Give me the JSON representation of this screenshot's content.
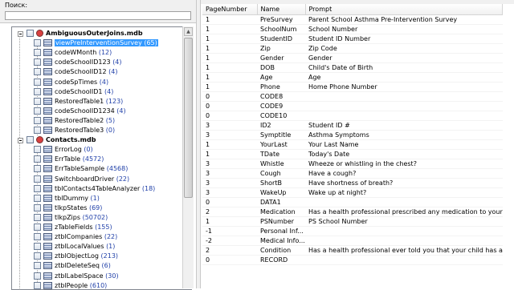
{
  "search": {
    "label": "Поиск:",
    "value": ""
  },
  "tree": {
    "databases": [
      {
        "name": "AmbiguousOuterJoins.mdb",
        "tables": [
          {
            "name": "viewPreInterventionSurvey",
            "count": "(65)",
            "selected": true
          },
          {
            "name": "codeWMonth",
            "count": "(12)"
          },
          {
            "name": "codeSchoolID123",
            "count": "(4)"
          },
          {
            "name": "codeSchoolID12",
            "count": "(4)"
          },
          {
            "name": "codeSpTimes",
            "count": "(4)"
          },
          {
            "name": "codeSchoolID1",
            "count": "(4)"
          },
          {
            "name": "RestoredTable1",
            "count": "(123)"
          },
          {
            "name": "codeSchoolID1234",
            "count": "(4)"
          },
          {
            "name": "RestoredTable2",
            "count": "(5)"
          },
          {
            "name": "RestoredTable3",
            "count": "(0)"
          }
        ]
      },
      {
        "name": "Contacts.mdb",
        "tables": [
          {
            "name": "ErrorLog",
            "count": "(0)"
          },
          {
            "name": "ErrTable",
            "count": "(4572)"
          },
          {
            "name": "ErrTableSample",
            "count": "(4568)"
          },
          {
            "name": "SwitchboardDriver",
            "count": "(22)"
          },
          {
            "name": "tblContacts4TableAnalyzer",
            "count": "(18)"
          },
          {
            "name": "tblDummy",
            "count": "(1)"
          },
          {
            "name": "tlkpStates",
            "count": "(69)"
          },
          {
            "name": "tlkpZips",
            "count": "(50702)"
          },
          {
            "name": "zTableFields",
            "count": "(155)"
          },
          {
            "name": "ztblCompanies",
            "count": "(22)"
          },
          {
            "name": "ztblLocalValues",
            "count": "(1)"
          },
          {
            "name": "ztblObjectLog",
            "count": "(213)"
          },
          {
            "name": "ztblDeleteSeq",
            "count": "(6)"
          },
          {
            "name": "ztblLabelSpace",
            "count": "(30)"
          },
          {
            "name": "ztblPeople",
            "count": "(610)"
          }
        ]
      }
    ]
  },
  "grid": {
    "columns": [
      "PageNumber",
      "Name",
      "Prompt"
    ],
    "rows": [
      [
        "1",
        "PreSurvey",
        "Parent School Asthma Pre-Intervention Survey"
      ],
      [
        "1",
        "SchoolNum",
        "School Number"
      ],
      [
        "1",
        "StudentID",
        "Student ID Number"
      ],
      [
        "1",
        "Zip",
        "Zip Code"
      ],
      [
        "1",
        "Gender",
        "Gender"
      ],
      [
        "1",
        "DOB",
        "Child's Date of Birth"
      ],
      [
        "1",
        "Age",
        "Age"
      ],
      [
        "1",
        "Phone",
        "Home Phone Number"
      ],
      [
        "0",
        "CODE8",
        ""
      ],
      [
        "0",
        "CODE9",
        ""
      ],
      [
        "0",
        "CODE10",
        ""
      ],
      [
        "3",
        "ID2",
        "Student ID #"
      ],
      [
        "3",
        "Symptitle",
        "Asthma Symptoms"
      ],
      [
        "1",
        "YourLast",
        "Your Last Name"
      ],
      [
        "1",
        "TDate",
        "Today's Date"
      ],
      [
        "3",
        "Whistle",
        "Wheeze or whistling in the chest?"
      ],
      [
        "3",
        "Cough",
        "Have a cough?"
      ],
      [
        "3",
        "ShortB",
        "Have shortness of breath?"
      ],
      [
        "3",
        "WakeUp",
        "Wake up at night?"
      ],
      [
        "0",
        "DATA1",
        ""
      ],
      [
        "2",
        "Medication",
        "Has a health professional prescribed any medication to your"
      ],
      [
        "1",
        "PSNumber",
        "PS School Number"
      ],
      [
        "-1",
        "Personal Inf...",
        ""
      ],
      [
        "-2",
        "Medical Info...",
        ""
      ],
      [
        "2",
        "Condition",
        "Has a health professional ever told you that your child has a"
      ],
      [
        "0",
        "RECORD",
        ""
      ]
    ]
  }
}
